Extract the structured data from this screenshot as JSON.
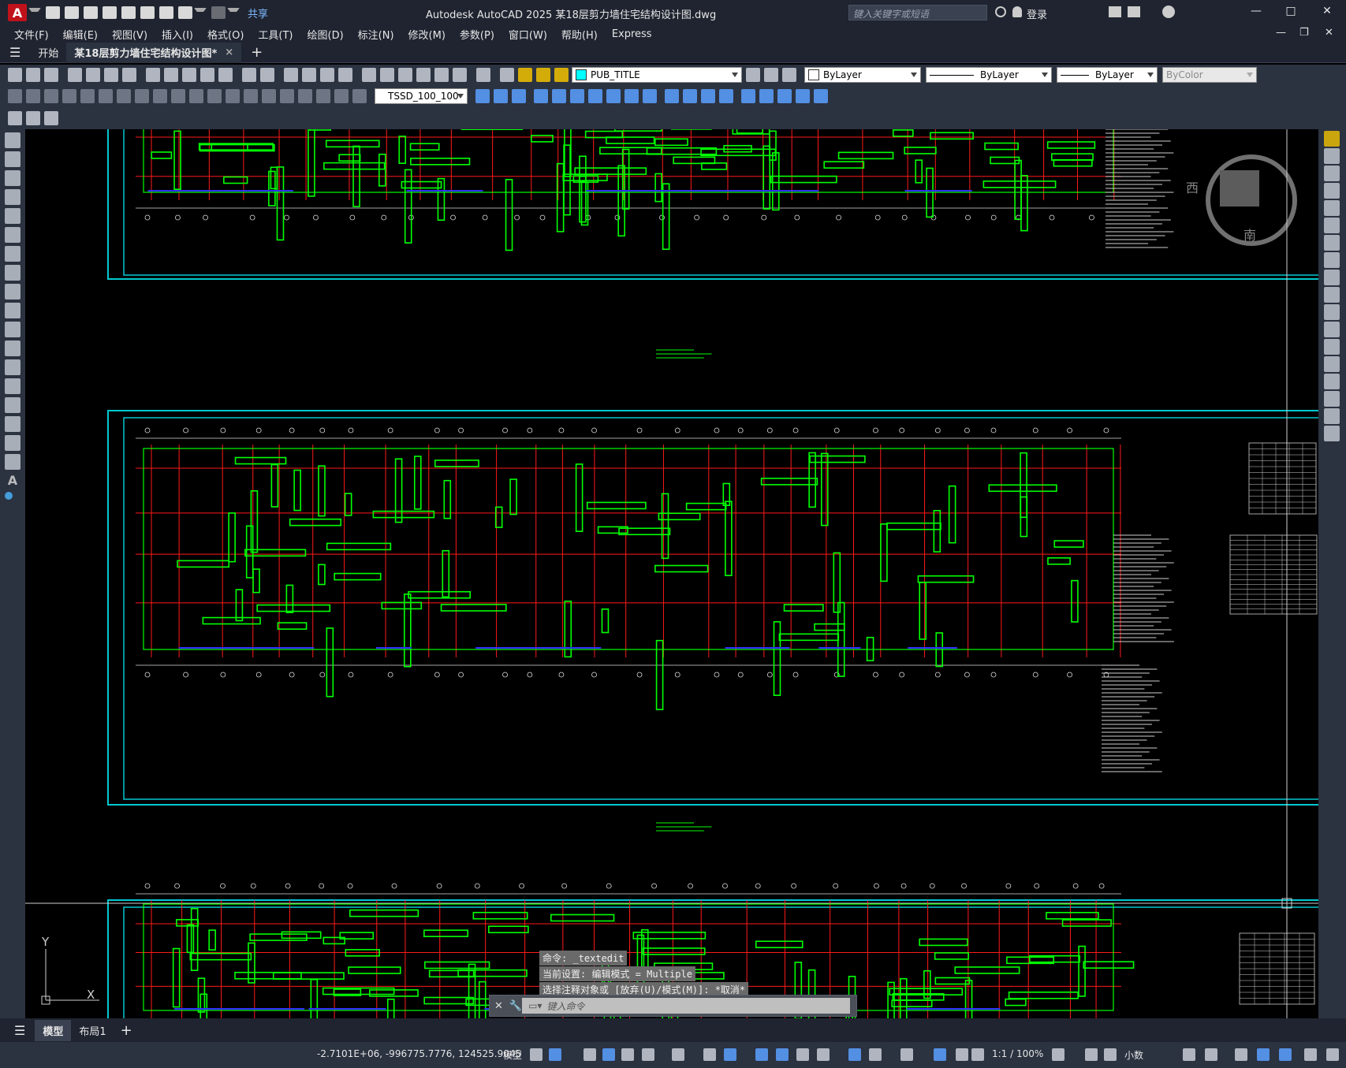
{
  "app": {
    "logo_letter": "A",
    "window_title": "Autodesk AutoCAD 2025    某18层剪力墙住宅结构设计图.dwg",
    "share_label": "共享",
    "search_placeholder": "键入关键字或短语",
    "login_label": "登录"
  },
  "menu": [
    "文件(F)",
    "编辑(E)",
    "视图(V)",
    "插入(I)",
    "格式(O)",
    "工具(T)",
    "绘图(D)",
    "标注(N)",
    "修改(M)",
    "参数(P)",
    "窗口(W)",
    "帮助(H)",
    "Express"
  ],
  "tabs": {
    "start": "开始",
    "drawing": "某18层剪力墙住宅结构设计图*",
    "close": "×",
    "add": "+"
  },
  "properties": {
    "layer": "PUB_TITLE",
    "color": "ByLayer",
    "linetype": "ByLayer",
    "lineweight": "ByLayer",
    "plotstyle": "ByColor",
    "dimstyle": "TSSD_100_100"
  },
  "command": {
    "history": [
      "命令: _textedit",
      "当前设置: 编辑模式 = Multiple",
      "选择注释对象或 [放弃(U)/模式(M)]: *取消*"
    ],
    "placeholder": "键入命令"
  },
  "ucs": {
    "y": "Y",
    "x": "X"
  },
  "viewcube": {
    "west": "西",
    "south": "南"
  },
  "layout_tabs": {
    "model": "模型",
    "layout1": "布局1",
    "add": "+"
  },
  "status": {
    "coordinates": "-2.7101E+06, -996775.7776, 124525.9045",
    "space": "模型",
    "scale": "1:1 / 100%",
    "units": "小数"
  },
  "colors": {
    "ui_bg": "#1f2430",
    "toolbar_bg": "#2b3240",
    "frame_cyan": "#00d8e0",
    "axis_red": "#ff1a1a",
    "wall_green": "#00ff00",
    "rebar_blue": "#3030ff"
  }
}
